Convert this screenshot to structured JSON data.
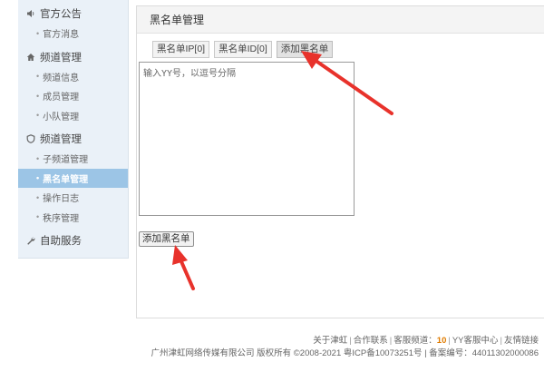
{
  "sidebar": {
    "groups": [
      {
        "label": "官方公告",
        "icon": "speaker-icon",
        "items": [
          {
            "label": "官方消息"
          }
        ]
      },
      {
        "label": "频道管理",
        "icon": "home-icon",
        "items": [
          {
            "label": "频道信息"
          },
          {
            "label": "成员管理"
          },
          {
            "label": "小队管理"
          }
        ]
      },
      {
        "label": "频道管理",
        "icon": "shield-icon",
        "items": [
          {
            "label": "子频道管理"
          },
          {
            "label": "黑名单管理",
            "active": true
          },
          {
            "label": "操作日志"
          },
          {
            "label": "秩序管理"
          }
        ]
      },
      {
        "label": "自助服务",
        "icon": "wrench-icon",
        "items": []
      }
    ]
  },
  "panel": {
    "title": "黑名单管理",
    "tabs": [
      {
        "label": "黑名单IP[0]"
      },
      {
        "label": "黑名单ID[0]"
      },
      {
        "label": "添加黑名单",
        "active": true
      }
    ],
    "textarea_placeholder": "输入YY号，以逗号分隔",
    "add_button_label": "添加黑名单"
  },
  "footer": {
    "line1": {
      "about": "关于津虹",
      "contact": "合作联系",
      "service_channel_label": "客服频道：",
      "service_channel_number": "10",
      "yy_service": "YY客服中心",
      "links": "友情链接"
    },
    "line2": "广州津虹网络传媒有限公司 版权所有 ©2008-2021 粤ICP备10073251号 | 备案编号：44011302000086"
  },
  "colors": {
    "sidebar_bg": "#eaf1f8",
    "active_item_bg": "#9cc5e6",
    "annotation_arrow": "#e8322b",
    "highlight_number": "#e07b00"
  }
}
